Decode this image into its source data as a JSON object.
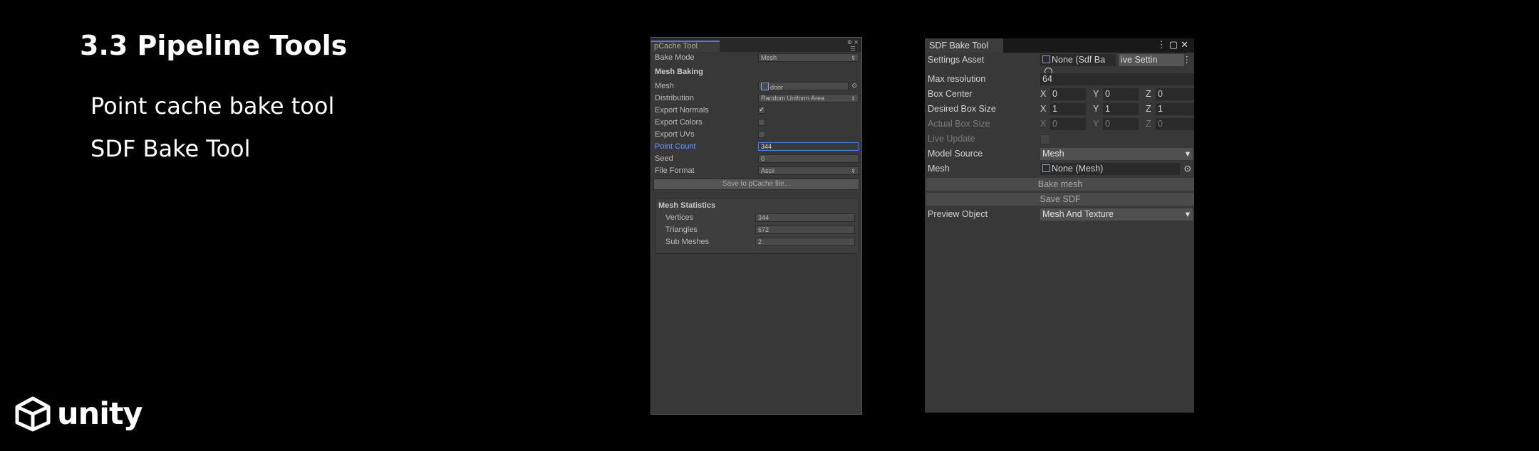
{
  "slide": {
    "title": "3.3 Pipeline Tools",
    "bullets": [
      "Point cache bake tool",
      "SDF Bake Tool"
    ],
    "logo_text": "unity"
  },
  "pcache": {
    "tab": "pCache Tool",
    "bake_mode": {
      "label": "Bake Mode",
      "value": "Mesh"
    },
    "mesh_baking": "Mesh Baking",
    "mesh": {
      "label": "Mesh",
      "value": "door"
    },
    "distribution": {
      "label": "Distribution",
      "value": "Random Uniform Area"
    },
    "export_normals": {
      "label": "Export Normals",
      "checked": true
    },
    "export_colors": {
      "label": "Export Colors",
      "checked": false
    },
    "export_uvs": {
      "label": "Export UVs",
      "checked": false
    },
    "point_count": {
      "label": "Point Count",
      "value": "344"
    },
    "seed": {
      "label": "Seed",
      "value": "0"
    },
    "file_format": {
      "label": "File Format",
      "value": "Ascii"
    },
    "save_button": "Save to pCache file...",
    "stats": {
      "title": "Mesh Statistics",
      "rows": [
        {
          "label": "Vertices",
          "value": "344"
        },
        {
          "label": "Triangles",
          "value": "672"
        },
        {
          "label": "Sub Meshes",
          "value": "2"
        }
      ]
    }
  },
  "sdf": {
    "tab": "SDF Bake Tool",
    "settings_asset": {
      "label": "Settings Asset",
      "value": "None (Sdf Ba",
      "button": "ive Settin"
    },
    "max_resolution": {
      "label": "Max resolution",
      "value": "64"
    },
    "box_center": {
      "label": "Box Center",
      "x": "0",
      "y": "0",
      "z": "0"
    },
    "desired_box_size": {
      "label": "Desired Box Size",
      "x": "1",
      "y": "1",
      "z": "1"
    },
    "actual_box_size": {
      "label": "Actual Box Size",
      "x": "0",
      "y": "0",
      "z": "0"
    },
    "live_update": {
      "label": "Live Update"
    },
    "model_source": {
      "label": "Model Source",
      "value": "Mesh"
    },
    "mesh": {
      "label": "Mesh",
      "value": "None (Mesh)"
    },
    "bake_mesh_button": "Bake mesh",
    "save_sdf_button": "Save SDF",
    "preview_object": {
      "label": "Preview Object",
      "value": "Mesh And Texture"
    },
    "axis": {
      "x": "X",
      "y": "Y",
      "z": "Z"
    }
  }
}
